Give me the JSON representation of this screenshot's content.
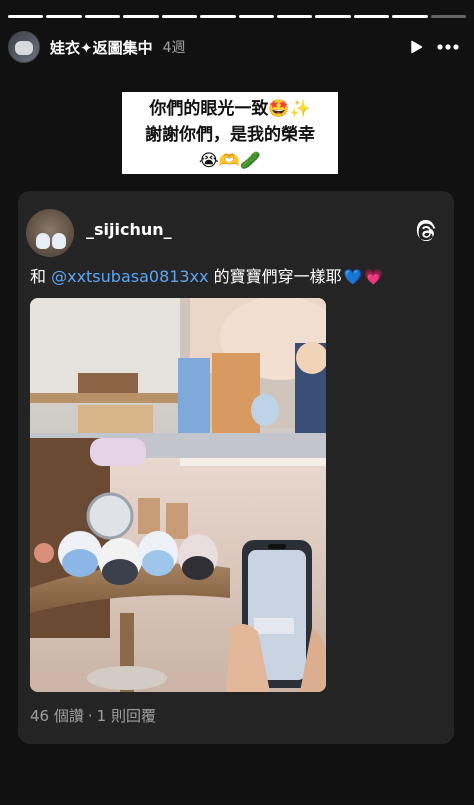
{
  "story": {
    "title": "娃衣✦返圖集中",
    "time": "4週",
    "progress_segments": 12,
    "progress_done": 11
  },
  "icons": {
    "play": "play-icon",
    "more": "more-options-icon",
    "threads": "threads-logo-icon"
  },
  "sticker": {
    "line1": "你們的眼光一致🤩✨",
    "line2": "謝謝你們，是我的榮幸",
    "line3": "😭🫶🥒"
  },
  "post": {
    "username": "_sijichun_",
    "text_prefix": "和 ",
    "mention": "@xxtsubasa0813xx",
    "text_suffix": " 的寶寶們穿一樣耶",
    "heart_blue": "💙",
    "heart_pink": "💗",
    "likes": "46 個讚",
    "separator": "·",
    "replies": "1 則回覆"
  },
  "colors": {
    "background": "#111111",
    "card": "#242424",
    "mention": "#5aa6f5"
  }
}
